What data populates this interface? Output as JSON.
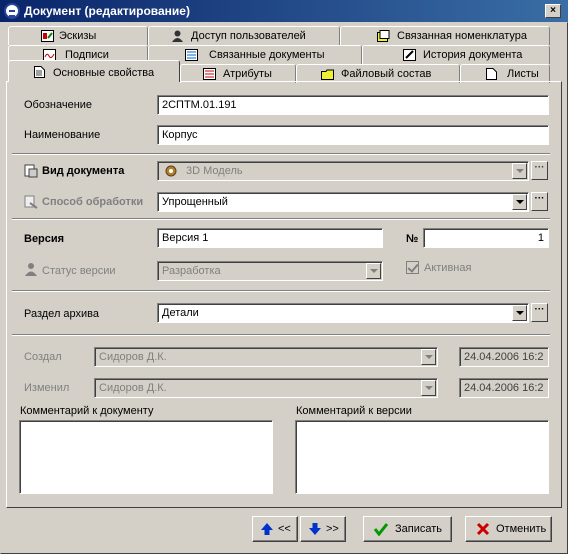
{
  "window": {
    "title": "Документ (редактирование)",
    "close_label": "×"
  },
  "tabs": {
    "row1": [
      "Эскизы",
      "Доступ пользователей",
      "Связанная номенклатура"
    ],
    "row2": [
      "Подписи",
      "Связанные документы",
      "История документа"
    ],
    "row3": [
      "Основные свойства",
      "Атрибуты",
      "Файловый состав",
      "Листы"
    ]
  },
  "form": {
    "designation_label": "Обозначение",
    "designation_value": "2СПТМ.01.191",
    "name_label": "Наименование",
    "name_value": "Корпус",
    "doc_type_label": "Вид документа",
    "doc_type_value": "3D Модель",
    "processing_label": "Способ обработки",
    "processing_value": "Упрощенный",
    "version_label": "Версия",
    "version_value": "Версия 1",
    "number_label": "№",
    "number_value": "1",
    "version_status_label": "Статус версии",
    "version_status_value": "Разработка",
    "active_label": "Активная",
    "archive_label": "Раздел архива",
    "archive_value": "Детали",
    "created_label": "Создал",
    "created_by": "Сидоров Д.К.",
    "created_date": "24.04.2006 16:2",
    "modified_label": "Изменил",
    "modified_by": "Сидоров Д.К.",
    "modified_date": "24.04.2006 16:2",
    "doc_comment_label": "Комментарий к документу",
    "version_comment_label": "Комментарий к версии",
    "ellipsis": "···"
  },
  "buttons": {
    "prev": "<<",
    "next": ">>",
    "save": "Записать",
    "cancel": "Отменить"
  }
}
